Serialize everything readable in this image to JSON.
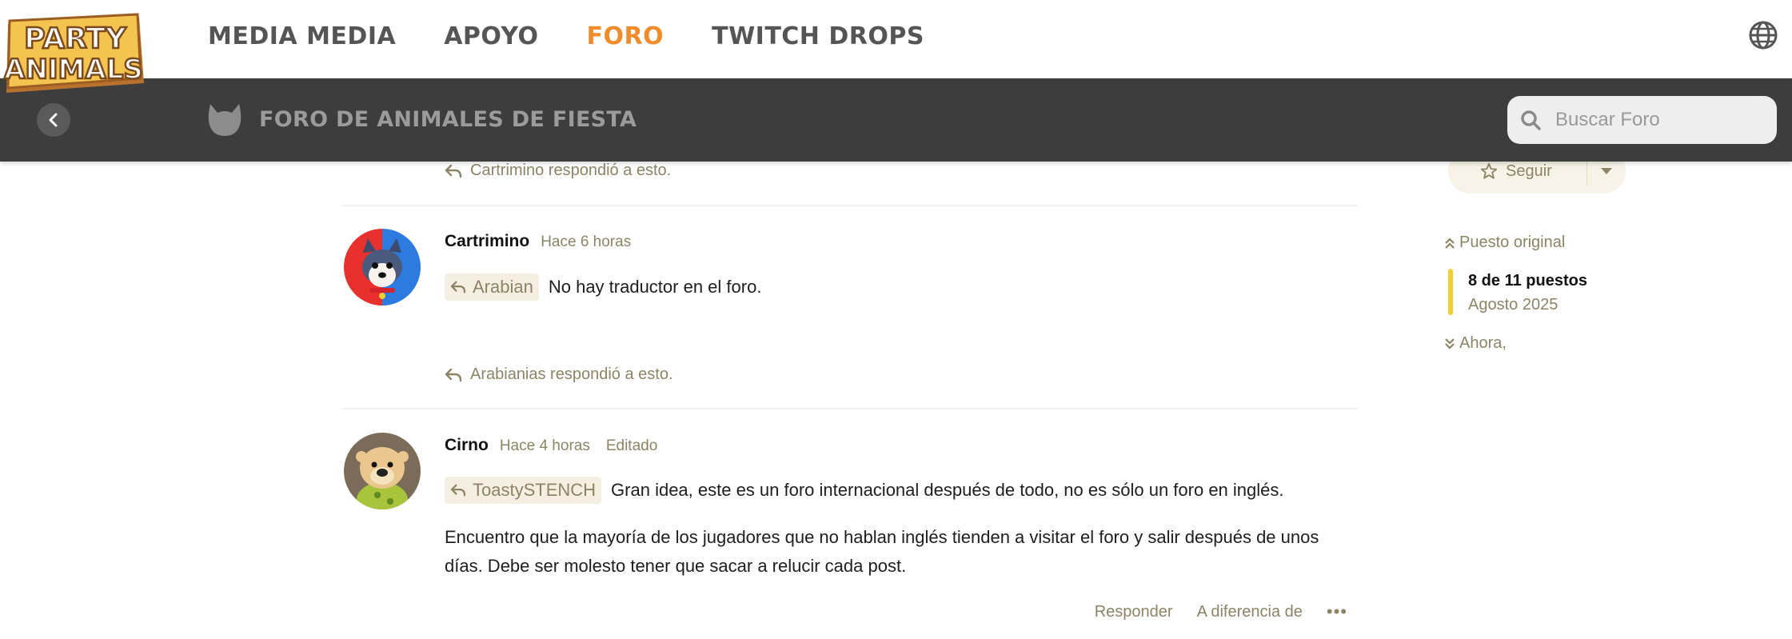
{
  "logo": {
    "line1": "PARTY",
    "line2": "ANIMALS",
    "icon": "party-animals-logo"
  },
  "nav": {
    "items": [
      {
        "label": "MEDIA MEDIA",
        "active": false
      },
      {
        "label": "APOYO",
        "active": false
      },
      {
        "label": "FORO",
        "active": true
      },
      {
        "label": "TWITCH DROPS",
        "active": false
      }
    ],
    "language_icon": "globe-icon"
  },
  "forum_bar": {
    "back_icon": "chevron-left-icon",
    "forum_icon": "animal-head-icon",
    "title": "FORO DE ANIMALES DE FIESTA",
    "search_placeholder": "Buscar Foro"
  },
  "thread": {
    "top_reply_note": "Cartrimino respondió a esto.",
    "posts": [
      {
        "author": "Cartrimino",
        "time": "Hace 6 horas",
        "reply_to": "Arabian",
        "text": "No hay traductor en el foro.",
        "replied_note": "Arabianias respondió a esto.",
        "avatar": "husky-dog-avatar"
      },
      {
        "author": "Cirno",
        "time": "Hace 4 horas",
        "edited": "Editado",
        "reply_to": "ToastySTENCH",
        "text": "Gran idea, este es un foro internacional después de todo, no es sólo un foro en inglés.",
        "paragraph": "Encuentro que la mayoría de los jugadores que no hablan inglés tienden a visitar el foro y salir después de unos días. Debe ser molesto tener que sacar a relucir cada post.",
        "avatar": "otter-avatar",
        "actions": {
          "reply": "Responder",
          "like": "A diferencia de",
          "more": "•••"
        }
      }
    ]
  },
  "sidebar": {
    "follow_label": "Seguir",
    "timeline": {
      "original": "Puesto original",
      "count": "8 de 11 puestos",
      "date": "Agosto 2025",
      "now": "Ahora,"
    }
  },
  "colors": {
    "accent": "#f28b2a",
    "forum_bar": "#3d3d3d",
    "muted_gold": "#8d8466",
    "timeline_bar": "#f1cf2f",
    "chip_bg": "#f4efe1"
  }
}
